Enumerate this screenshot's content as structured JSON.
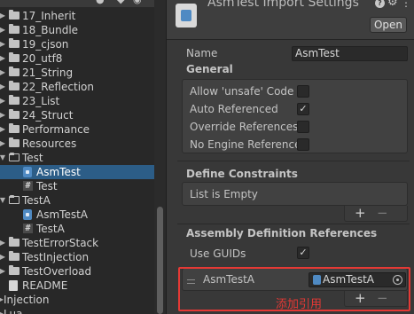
{
  "project": {
    "toolbar": {
      "count": "5"
    },
    "tree": [
      {
        "label": "17_Inherit",
        "type": "folder",
        "depth": 0,
        "arrow": "right"
      },
      {
        "label": "18_Bundle",
        "type": "folder",
        "depth": 0,
        "arrow": "right"
      },
      {
        "label": "19_cjson",
        "type": "folder",
        "depth": 0,
        "arrow": "right"
      },
      {
        "label": "20_utf8",
        "type": "folder",
        "depth": 0,
        "arrow": "right"
      },
      {
        "label": "21_String",
        "type": "folder",
        "depth": 0,
        "arrow": "right"
      },
      {
        "label": "22_Reflection",
        "type": "folder",
        "depth": 0,
        "arrow": "right"
      },
      {
        "label": "23_List",
        "type": "folder",
        "depth": 0,
        "arrow": "right"
      },
      {
        "label": "24_Struct",
        "type": "folder",
        "depth": 0,
        "arrow": "right"
      },
      {
        "label": "Performance",
        "type": "folder",
        "depth": 0,
        "arrow": "right"
      },
      {
        "label": "Resources",
        "type": "folder",
        "depth": 0,
        "arrow": "right"
      },
      {
        "label": "Test",
        "type": "folder-open",
        "depth": 0,
        "arrow": "down"
      },
      {
        "label": "AsmTest",
        "type": "asmdef",
        "depth": 1,
        "arrow": "",
        "selected": true
      },
      {
        "label": "Test",
        "type": "script",
        "depth": 1,
        "arrow": ""
      },
      {
        "label": "TestA",
        "type": "folder-open",
        "depth": 0,
        "arrow": "down"
      },
      {
        "label": "AsmTestA",
        "type": "asmdef",
        "depth": 1,
        "arrow": ""
      },
      {
        "label": "TestA",
        "type": "script",
        "depth": 1,
        "arrow": ""
      },
      {
        "label": "TestErrorStack",
        "type": "folder",
        "depth": 0,
        "arrow": "right"
      },
      {
        "label": "TestInjection",
        "type": "folder",
        "depth": 0,
        "arrow": "right"
      },
      {
        "label": "TestOverload",
        "type": "folder",
        "depth": 0,
        "arrow": "right"
      },
      {
        "label": "README",
        "type": "document",
        "depth": 0,
        "arrow": ""
      },
      {
        "label": "Injection",
        "type": "folder",
        "depth": -1,
        "arrow": "right"
      },
      {
        "label": "Lua",
        "type": "folder",
        "depth": -1,
        "arrow": "right"
      }
    ]
  },
  "inspector": {
    "title": "AsmTest Import Settings",
    "open_button": "Open",
    "name_label": "Name",
    "name_value": "AsmTest",
    "general": {
      "title": "General",
      "options": [
        {
          "label": "Allow 'unsafe' Code",
          "checked": false
        },
        {
          "label": "Auto Referenced",
          "checked": true
        },
        {
          "label": "Override References",
          "checked": false
        },
        {
          "label": "No Engine References",
          "checked": false
        }
      ]
    },
    "define_constraints": {
      "title": "Define Constraints",
      "empty_text": "List is Empty",
      "add": "+",
      "remove": "−"
    },
    "assembly_refs": {
      "title": "Assembly Definition References",
      "use_guids_label": "Use GUIDs",
      "use_guids_checked": true,
      "item_label": "AsmTestA",
      "item_value": "AsmTestA",
      "add": "+",
      "remove": "−"
    }
  },
  "annotation": "添加引用",
  "colors": {
    "selection": "#2c5d87",
    "highlight": "#e53935",
    "asmdef_icon": "#4f8ac3"
  }
}
